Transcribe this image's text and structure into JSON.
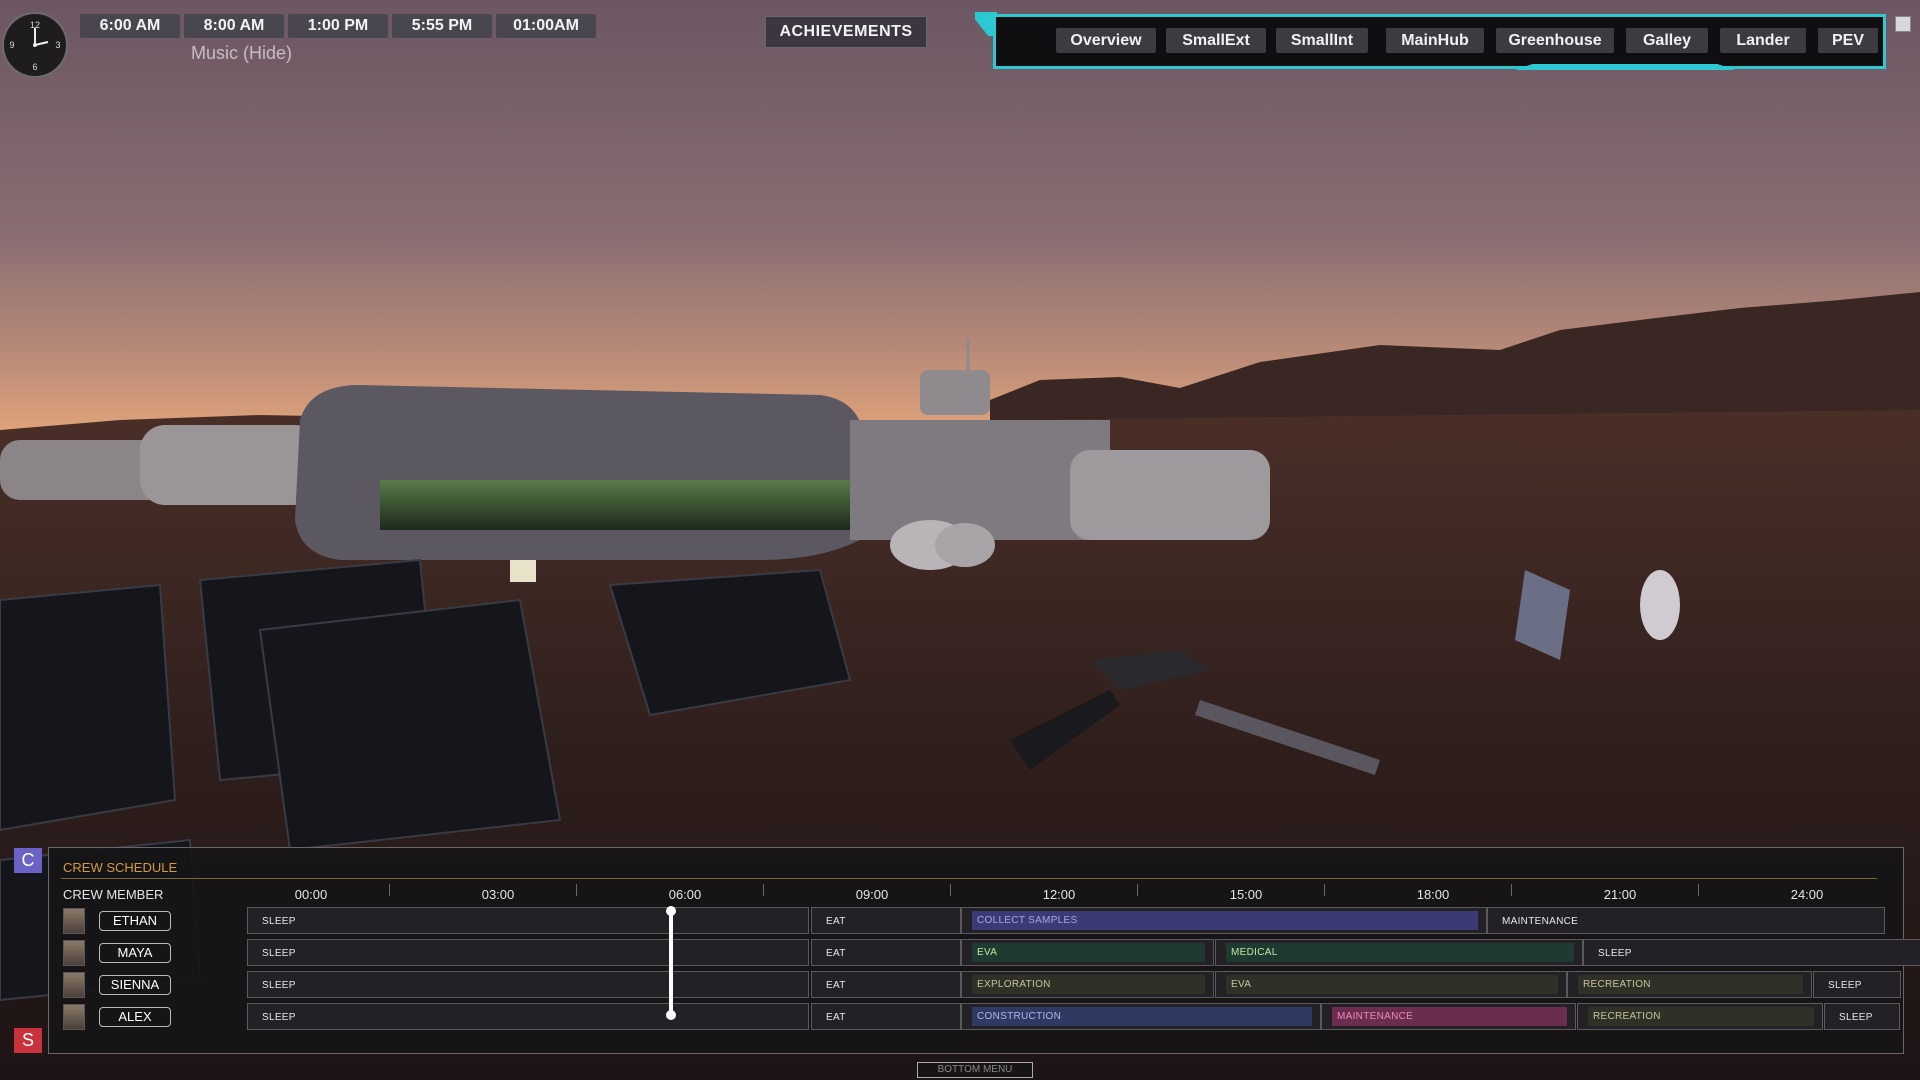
{
  "time_presets": [
    "6:00 AM",
    "8:00 AM",
    "1:00 PM",
    "5:55 PM",
    "01:00AM"
  ],
  "music_label": "Music (Hide)",
  "clock": {
    "numerals": [
      "12",
      "3",
      "6",
      "9"
    ]
  },
  "achievements_label": "ACHIEVEMENTS",
  "nav": {
    "items": [
      "Overview",
      "SmallExt",
      "SmallInt",
      "MainHub",
      "Greenhouse",
      "Galley",
      "Lander",
      "PEV"
    ],
    "accent_color": "#2cc9d2"
  },
  "side_buttons": {
    "c": "C",
    "s": "S"
  },
  "schedule": {
    "title": "CREW SCHEDULE",
    "column_header": "CREW MEMBER",
    "ticks": [
      "00:00",
      "03:00",
      "06:00",
      "09:00",
      "12:00",
      "15:00",
      "18:00",
      "21:00",
      "24:00"
    ],
    "current_time_marker": "06:00",
    "crew": [
      {
        "name": "ETHAN",
        "activities": [
          {
            "label": "SLEEP",
            "style": "plain"
          },
          {
            "label": "EAT",
            "style": "plain"
          },
          {
            "label": "COLLECT SAMPLES",
            "style": "purple"
          },
          {
            "label": "MAINTENANCE",
            "style": "plain"
          }
        ]
      },
      {
        "name": "MAYA",
        "activities": [
          {
            "label": "SLEEP",
            "style": "plain"
          },
          {
            "label": "EAT",
            "style": "plain"
          },
          {
            "label": "EVA",
            "style": "green"
          },
          {
            "label": "MEDICAL",
            "style": "green"
          },
          {
            "label": "SLEEP",
            "style": "plain"
          }
        ]
      },
      {
        "name": "SIENNA",
        "activities": [
          {
            "label": "SLEEP",
            "style": "plain"
          },
          {
            "label": "EAT",
            "style": "plain"
          },
          {
            "label": "EXPLORATION",
            "style": "olive"
          },
          {
            "label": "EVA",
            "style": "olive"
          },
          {
            "label": "RECREATION",
            "style": "olive"
          },
          {
            "label": "SLEEP",
            "style": "plain"
          }
        ]
      },
      {
        "name": "ALEX",
        "activities": [
          {
            "label": "SLEEP",
            "style": "plain"
          },
          {
            "label": "EAT",
            "style": "plain"
          },
          {
            "label": "CONSTRUCTION",
            "style": "blue"
          },
          {
            "label": "MAINTENANCE",
            "style": "pink"
          },
          {
            "label": "RECREATION",
            "style": "olive"
          },
          {
            "label": "SLEEP",
            "style": "plain"
          }
        ]
      }
    ],
    "style_colors": {
      "plain": "#232126",
      "purple": "#3b3a74",
      "green": "#1f3a30",
      "olive": "#2f3126",
      "blue": "#2e3a62",
      "pink": "#6a2d4d"
    },
    "style_text": {
      "plain": "#e8e8e8",
      "purple": "#a7a4e6",
      "green": "#c9e3a4",
      "olive": "#c9c2a0",
      "blue": "#aeb8ee",
      "pink": "#e98ab6"
    }
  },
  "bottom_menu_label": "BOTTOM MENU"
}
